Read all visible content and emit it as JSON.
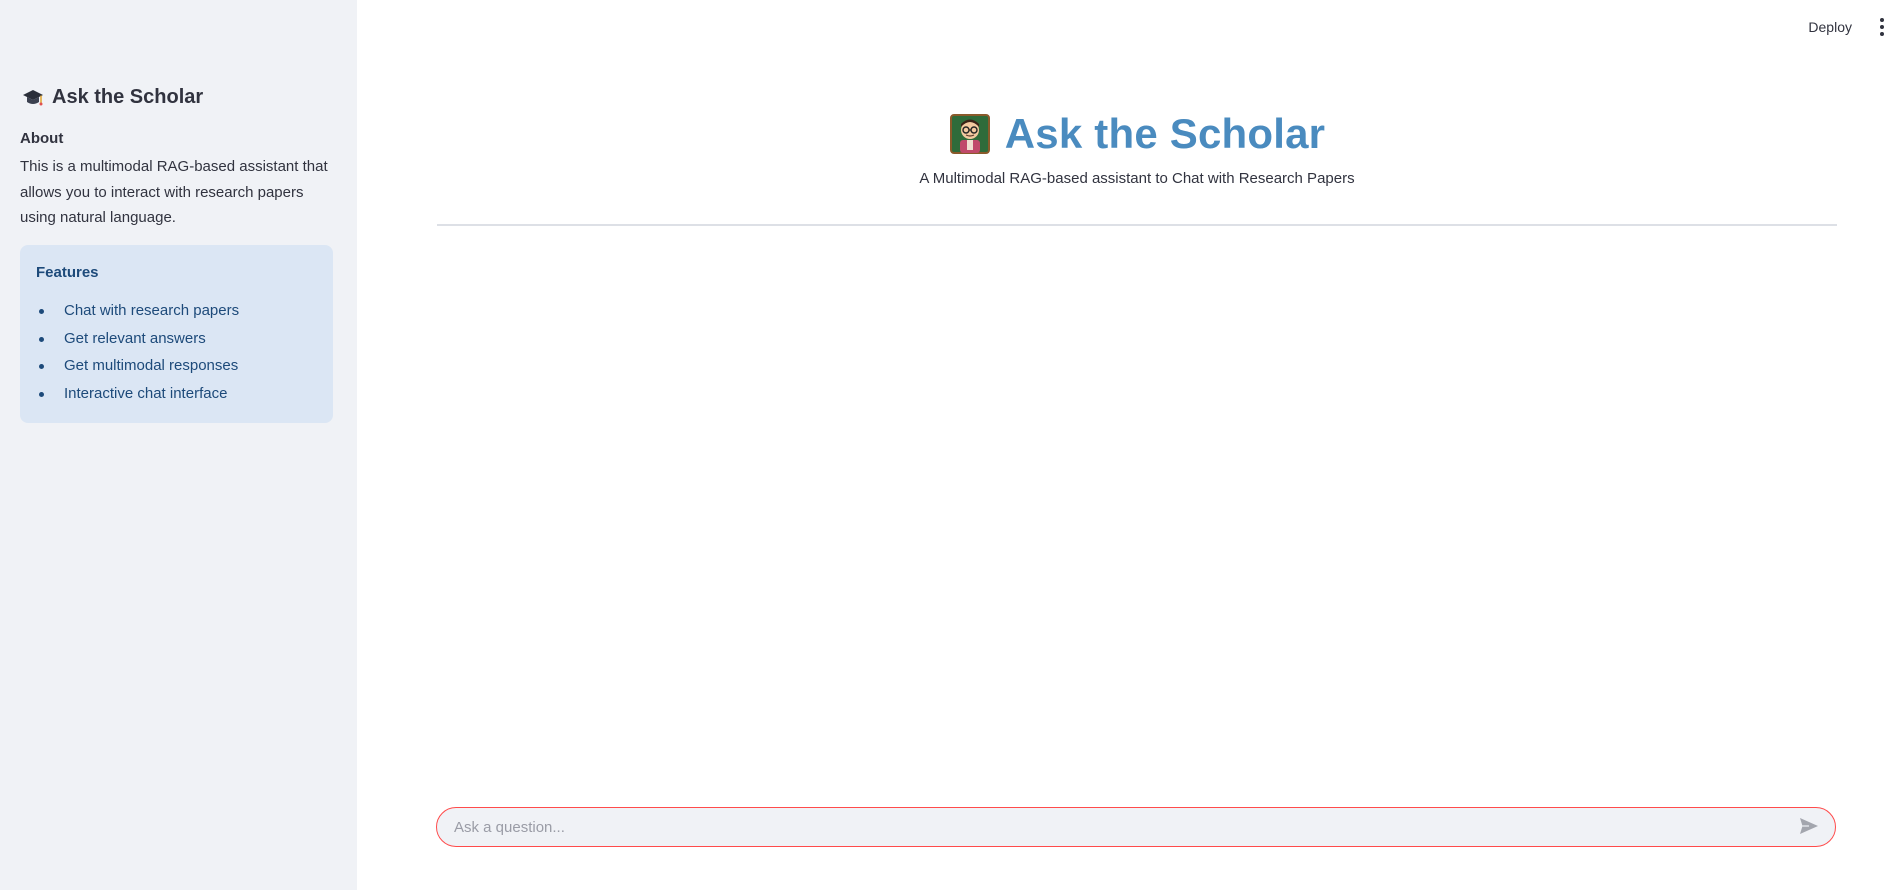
{
  "sidebar": {
    "title": "Ask the Scholar",
    "about_heading": "About",
    "about_text": "This is a multimodal RAG-based assistant that allows you to interact with research papers using natural language.",
    "features": {
      "heading": "Features",
      "items": [
        "Chat with research papers",
        "Get relevant answers",
        "Get multimodal responses",
        "Interactive chat interface"
      ]
    }
  },
  "toolbar": {
    "deploy_label": "Deploy",
    "menu_icon": "kebab-menu-icon"
  },
  "main": {
    "title": "Ask the Scholar",
    "title_icon": "scholar-icon",
    "subtitle": "A Multimodal RAG-based assistant to Chat with Research Papers"
  },
  "chat": {
    "placeholder": "Ask a question...",
    "value": "",
    "send_icon": "send-icon"
  },
  "colors": {
    "sidebar_bg": "#f0f2f6",
    "features_bg": "#dbe6f4",
    "features_text": "#1d4a7a",
    "title_color": "#4a8bbf",
    "input_border": "#ff4b4b"
  }
}
